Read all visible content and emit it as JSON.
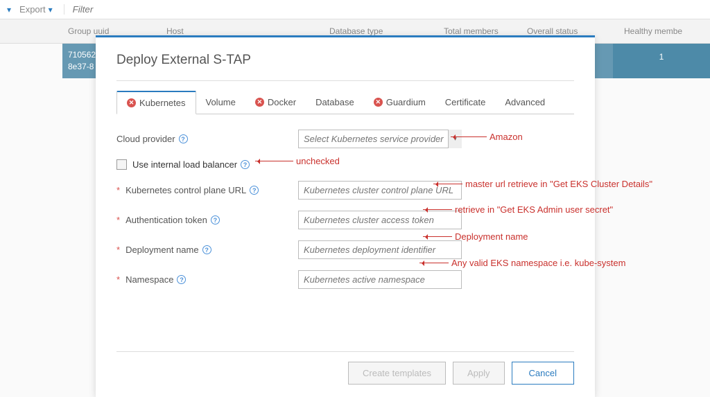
{
  "toolbar": {
    "export_label": "Export",
    "filter_placeholder": "Filter"
  },
  "table": {
    "headers": {
      "group": "Group uuid",
      "host": "Host",
      "dbtype": "Database type",
      "total": "Total members",
      "status": "Overall status",
      "healthy": "Healthy membe"
    },
    "row": {
      "group": "710562\n8e37-8",
      "healthy": "1"
    }
  },
  "dialog": {
    "title": "Deploy External S-TAP",
    "tabs": {
      "kubernetes": "Kubernetes",
      "volume": "Volume",
      "docker": "Docker",
      "database": "Database",
      "guardium": "Guardium",
      "certificate": "Certificate",
      "advanced": "Advanced"
    },
    "fields": {
      "cloud_provider_label": "Cloud provider",
      "cloud_provider_placeholder": "Select Kubernetes service provider",
      "use_lb_label": "Use internal load balancer",
      "control_url_label": "Kubernetes control plane URL",
      "control_url_placeholder": "Kubernetes cluster control plane URL",
      "auth_token_label": "Authentication token",
      "auth_token_placeholder": "Kubernetes cluster access token",
      "deploy_name_label": "Deployment name",
      "deploy_name_placeholder": "Kubernetes deployment identifier",
      "namespace_label": "Namespace",
      "namespace_placeholder": "Kubernetes active namespace"
    },
    "buttons": {
      "create": "Create templates",
      "apply": "Apply",
      "cancel": "Cancel"
    }
  },
  "annotations": {
    "amazon": "Amazon",
    "unchecked": "unchecked",
    "master_url": "master url  retrieve in  \"Get EKS Cluster Details\"",
    "admin_secret": "retrieve in  \"Get EKS Admin user secret\"",
    "deploy_name": "Deployment name",
    "namespace": "Any valid EKS namespace i.e. kube-system"
  }
}
